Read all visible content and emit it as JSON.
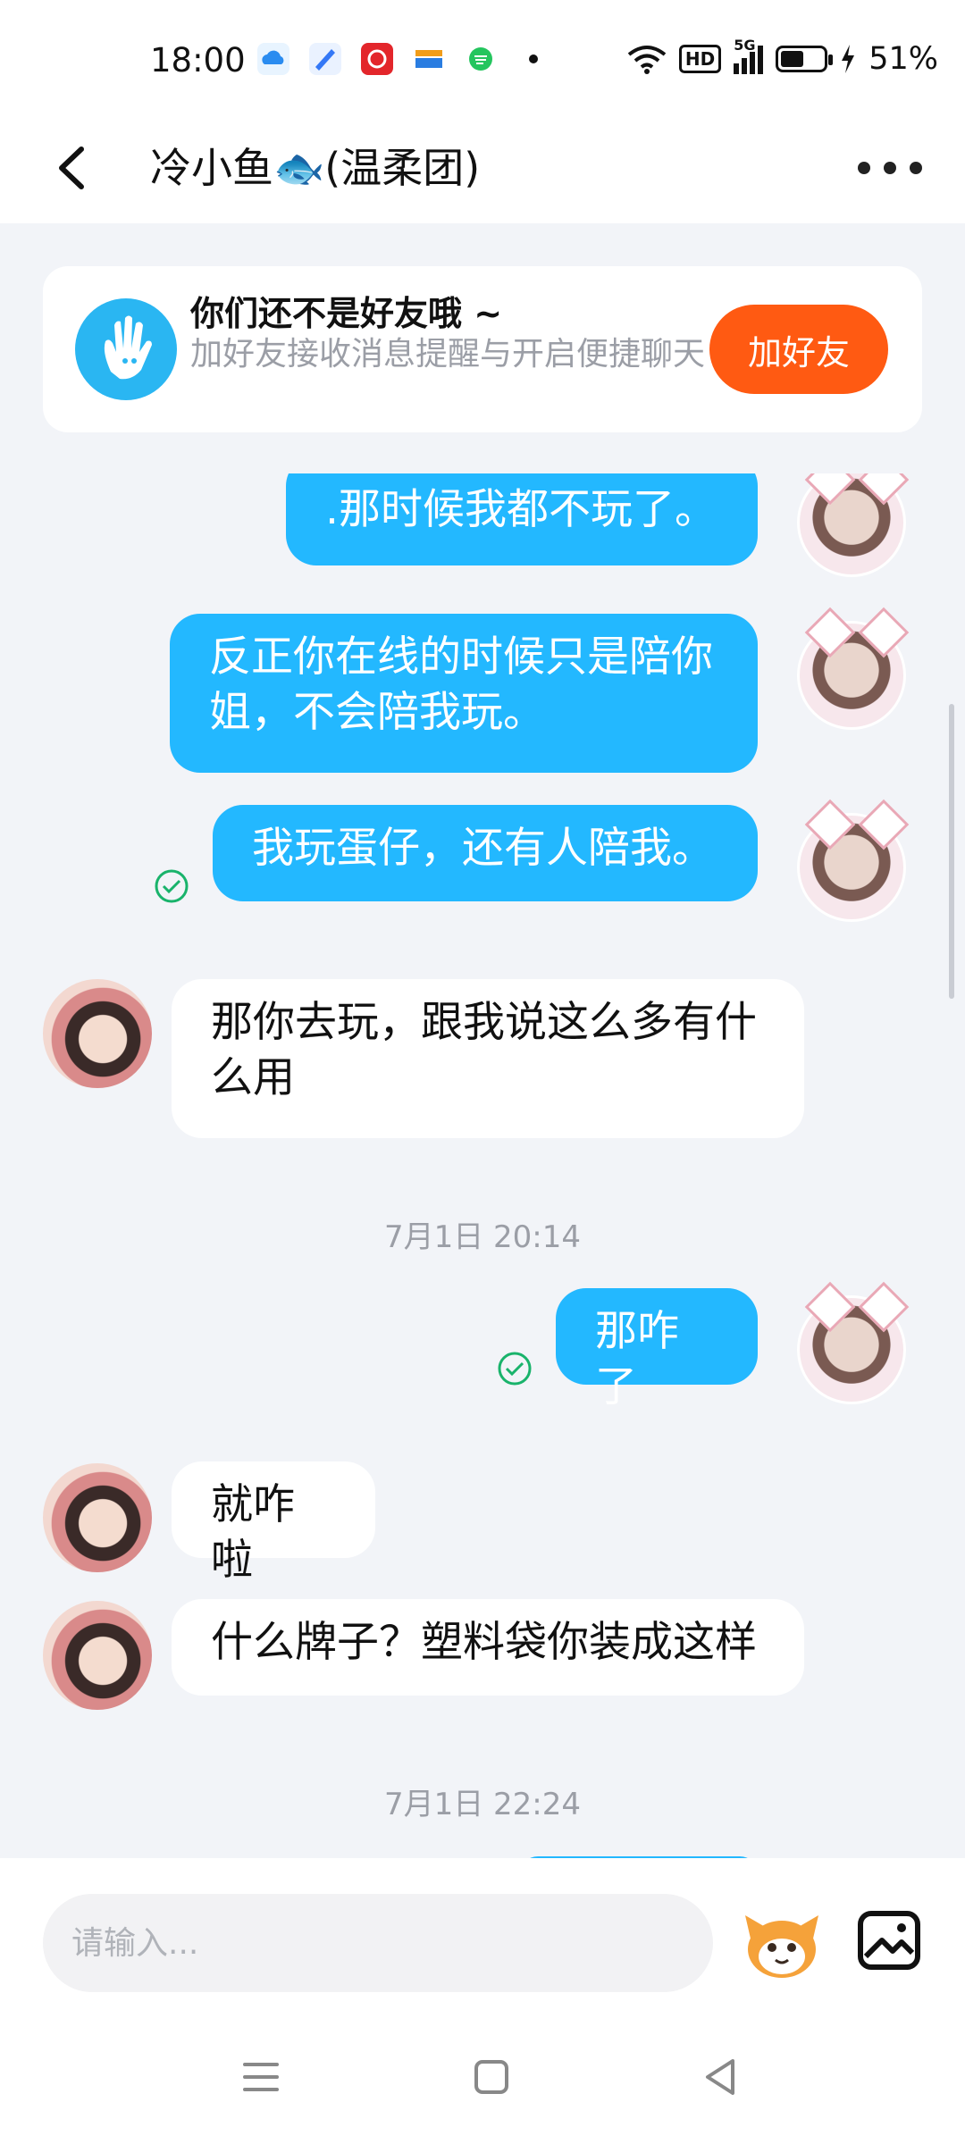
{
  "status_bar": {
    "time": "18:00",
    "app_icons": [
      "cloud-app-icon",
      "blue-app-icon",
      "red-app-icon",
      "wallet-app-icon",
      "green-app-icon"
    ],
    "network_badge": "HD",
    "network_type": "5G",
    "battery_percent": "51%"
  },
  "header": {
    "title": "冷小鱼🐟(温柔团)"
  },
  "friend_banner": {
    "title": "你们还不是好友哦 ~",
    "subtitle": "加好友接收消息提醒与开启便捷聊天",
    "add_button": "加好友"
  },
  "messages": [
    {
      "side": "out",
      "text": ".那时候我都不玩了。"
    },
    {
      "side": "out",
      "text": "反正你在线的时候只是陪你姐，不会陪我玩。"
    },
    {
      "side": "out",
      "text": "我玩蛋仔，还有人陪我。"
    },
    {
      "side": "in",
      "text": "那你去玩，跟我说这么多有什么用"
    },
    {
      "side": "out",
      "text": "那咋了"
    },
    {
      "side": "in",
      "text": "就咋啦"
    },
    {
      "side": "in",
      "text": "什么牌子？塑料袋你装成这样"
    }
  ],
  "timestamps": [
    "7月1日 20:14",
    "7月1日 22:24"
  ],
  "input_bar": {
    "placeholder": "请输入..."
  },
  "colors": {
    "outgoing_bubble": "#23b8ff",
    "add_friend_button": "#ff5a12",
    "banner_icon": "#2ab6f2",
    "read_check": "#19b36b"
  }
}
